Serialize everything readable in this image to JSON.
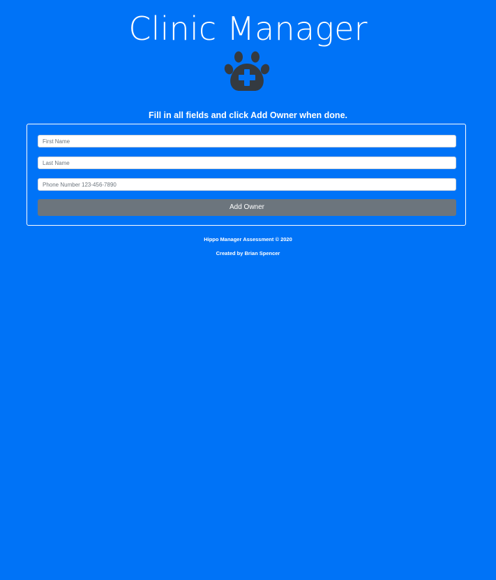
{
  "app": {
    "title": "Clinic Manager",
    "logo_icon": "paw-medical-cross-icon"
  },
  "form": {
    "instructions": "Fill in all fields and click Add Owner when done.",
    "first_name": {
      "value": "",
      "placeholder": "First Name"
    },
    "last_name": {
      "value": "",
      "placeholder": "Last Name"
    },
    "phone_number": {
      "value": "",
      "placeholder": "Phone Number 123-456-7890"
    },
    "submit_label": "Add Owner"
  },
  "footer": {
    "copyright": "Hippo Manager Assessment © 2020",
    "credit": "Created by Brian Spencer"
  },
  "colors": {
    "background": "#0073f7",
    "icon": "#343a40",
    "button": "#6c757d",
    "text": "#ffffff"
  }
}
